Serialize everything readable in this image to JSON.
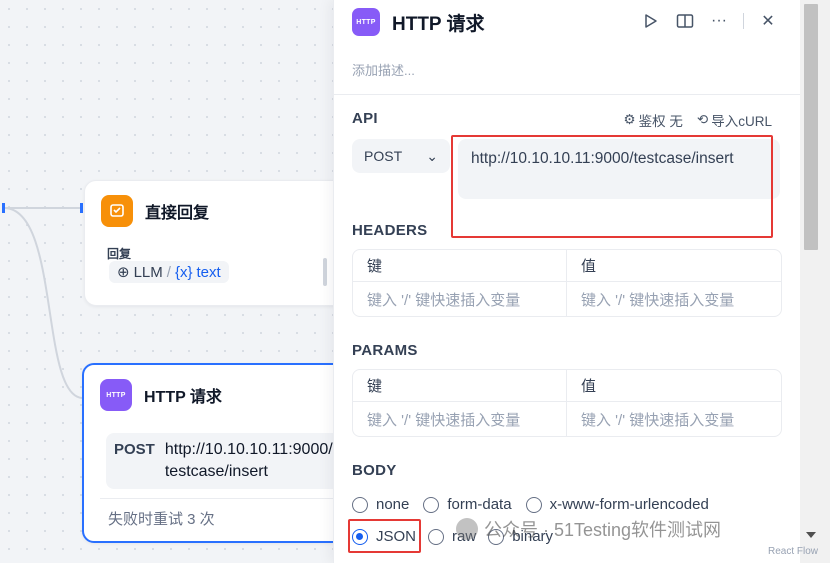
{
  "canvas": {
    "reply_node": {
      "title": "直接回复",
      "field_label": "回复",
      "chip_llm": "LLM",
      "chip_sep": "/",
      "chip_var_icon": "{x}",
      "chip_var": "text"
    },
    "http_node": {
      "title": "HTTP 请求",
      "icon_text": "HTTP",
      "method": "POST",
      "url": "http://10.10.10.11:9000/testcase/insert",
      "retry": "失败时重试 3 次"
    },
    "flow_label": "React Flow"
  },
  "panel": {
    "title": "HTTP 请求",
    "icon_text": "HTTP",
    "description_placeholder": "添加描述...",
    "api": {
      "label": "API",
      "auth_label": "鉴权 无",
      "import_label": "导入cURL",
      "method": "POST",
      "url": "http://10.10.10.11:9000/testcase/insert"
    },
    "headers": {
      "label": "HEADERS",
      "key_header": "键",
      "value_header": "值",
      "key_placeholder": "键入 '/' 键快速插入变量",
      "value_placeholder": "键入 '/' 键快速插入变量"
    },
    "params": {
      "label": "PARAMS",
      "key_header": "键",
      "value_header": "值",
      "key_placeholder": "键入 '/' 键快速插入变量",
      "value_placeholder": "键入 '/' 键快速插入变量"
    },
    "body": {
      "label": "BODY",
      "options": [
        "none",
        "form-data",
        "x-www-form-urlencoded",
        "JSON",
        "raw",
        "binary"
      ],
      "selected": "JSON"
    }
  },
  "watermark": "公众号 · 51Testing软件测试网",
  "colors": {
    "accent": "#155eef",
    "selected_border": "#2970ff",
    "highlight": "#e53935",
    "reply_icon": "#f79009",
    "http_icon": "#875bf7"
  },
  "icons": [
    "reply-icon",
    "http-icon",
    "run-icon",
    "book-icon",
    "more-icon",
    "close-icon",
    "gear-icon",
    "import-icon",
    "chevron-down-icon"
  ]
}
